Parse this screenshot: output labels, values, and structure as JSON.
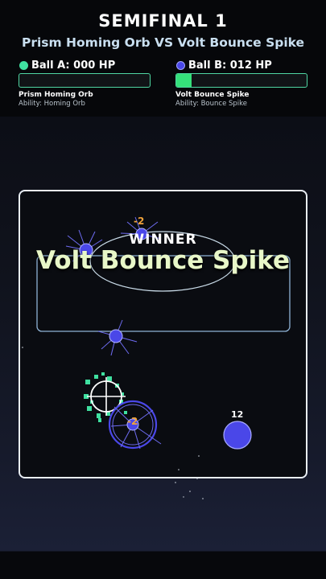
{
  "header": {
    "title": "SEMIFINAL 1",
    "matchup": "Prism Homing Orb  VS  Volt Bounce Spike"
  },
  "player_a": {
    "label": "Ball A: 000 HP",
    "hp": 0,
    "name": "Prism Homing Orb",
    "ability": "Ability: Homing Orb",
    "color": "#3fe0a0"
  },
  "player_b": {
    "label": "Ball B: 012 HP",
    "hp": 12,
    "name": "Volt Bounce Spike",
    "ability": "Ability: Bounce Spike",
    "color": "#4a47e8"
  },
  "overlay": {
    "winner_label": "WINNER",
    "winner_name": "Volt Bounce Spike"
  },
  "arena": {
    "damage_popups": [
      "-2",
      "-2"
    ],
    "ball_hp_label": "12"
  },
  "colors": {
    "hp_bar_fill": "#35e07a",
    "hp_bar_border": "#4fd6a3",
    "winner_name": "#e8f7c8",
    "damage_text": "#f0a23a"
  }
}
